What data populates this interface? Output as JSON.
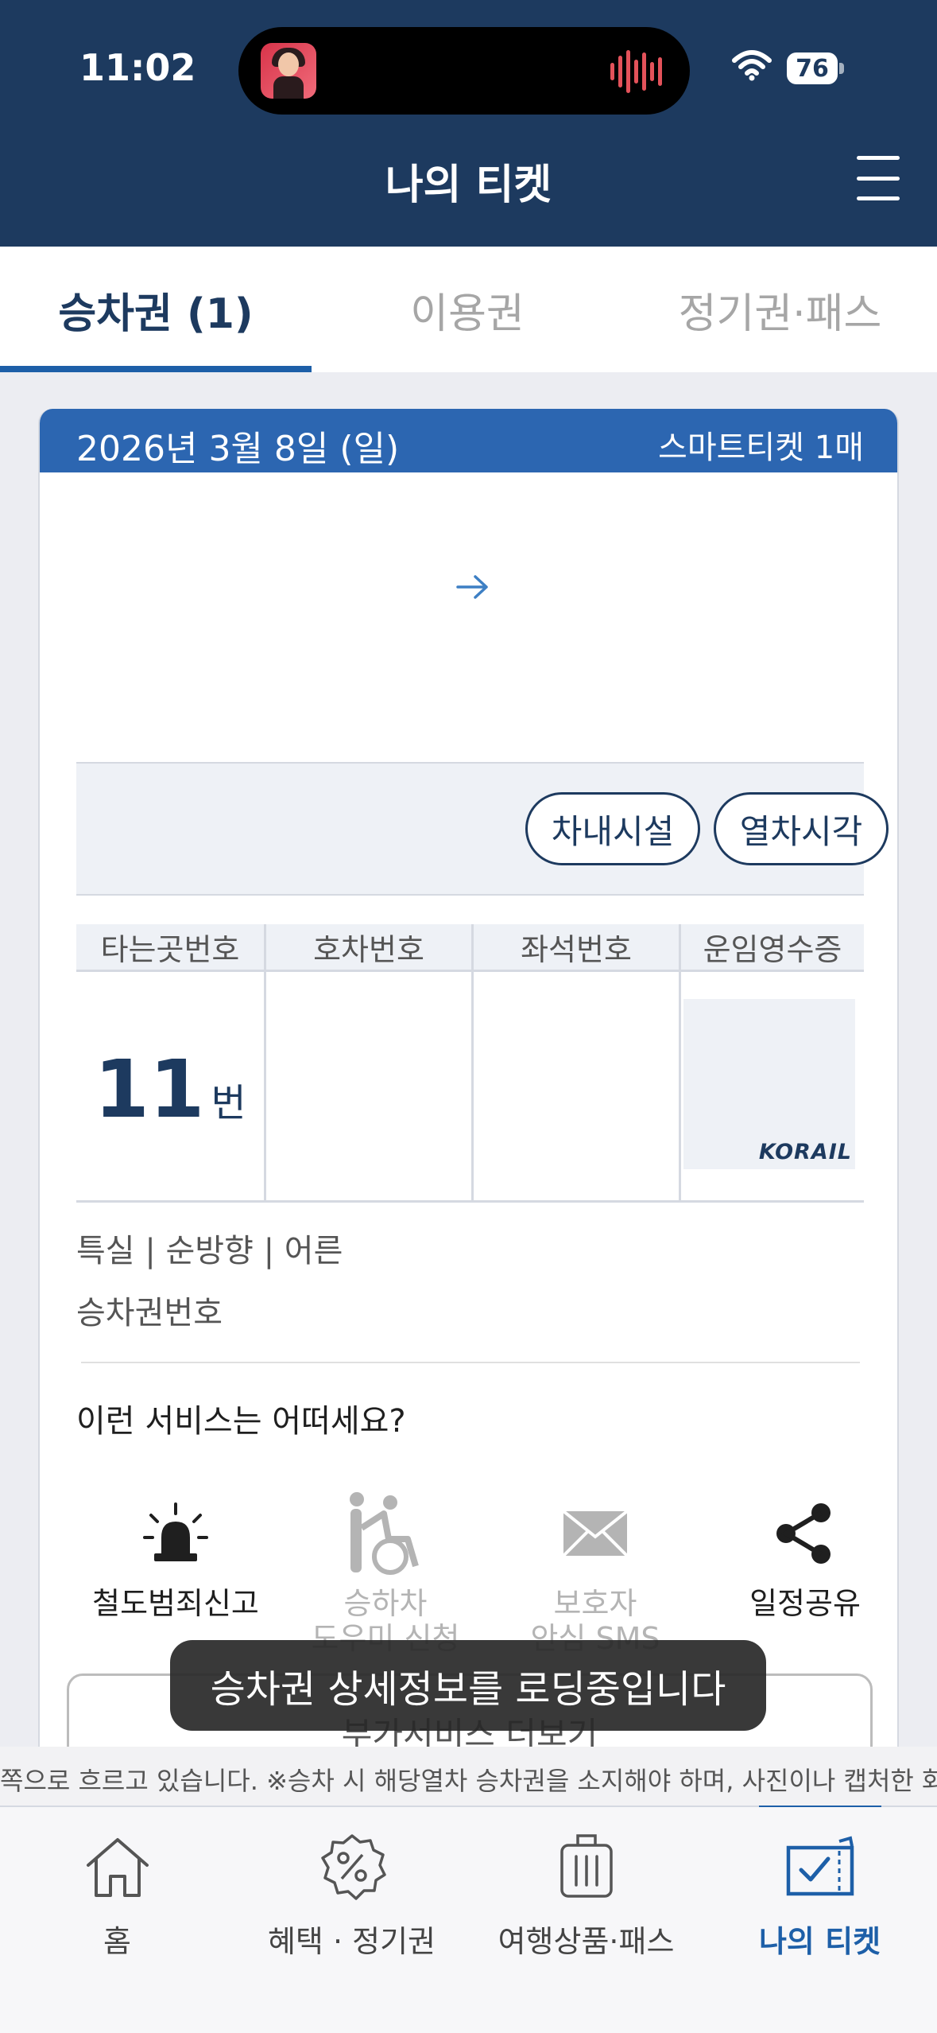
{
  "status_bar": {
    "time": "11:02",
    "battery": "76"
  },
  "header": {
    "title": "나의 티켓"
  },
  "tabs": [
    {
      "label": "승차권 (1)",
      "active": true
    },
    {
      "label": "이용권",
      "active": false
    },
    {
      "label": "정기권·패스",
      "active": false
    }
  ],
  "ticket": {
    "date": "2026년 3월 8일 (일)",
    "type": "스마트티켓 1매",
    "buttons": {
      "facilities": "차내시설",
      "timetable": "열차시각"
    },
    "table_headers": [
      "타는곳번호",
      "호차번호",
      "좌석번호",
      "운임영수증"
    ],
    "platform_number": "11",
    "platform_unit": "번",
    "receipt_logo": "KORAIL",
    "attributes": "특실 | 순방향 | 어른",
    "ticket_number_label": "승차권번호"
  },
  "services": {
    "title": "이런 서비스는 어떠세요?",
    "items": [
      {
        "label": "철도범죄신고",
        "icon": "siren-icon",
        "enabled": true
      },
      {
        "label": "승하차\n도우미 신청",
        "icon": "wheelchair-icon",
        "enabled": false
      },
      {
        "label": "보호자\n안심 SMS",
        "icon": "envelope-icon",
        "enabled": false
      },
      {
        "label": "일정공유",
        "icon": "share-icon",
        "enabled": true
      }
    ],
    "more_button": "부가서비스 더보기"
  },
  "toast": "승차권 상세정보를 로딩중입니다",
  "marquee": "쪽으로 흐르고 있습니다. ※승차 시 해당열차 승차권을 소지해야 하며, 사진이나 캡처한 화",
  "bottom_nav": [
    {
      "label": "홈",
      "icon": "home-icon",
      "active": false
    },
    {
      "label": "혜택 · 정기권",
      "icon": "discount-badge-icon",
      "active": false
    },
    {
      "label": "여행상품·패스",
      "icon": "suitcase-icon",
      "active": false
    },
    {
      "label": "나의 티켓",
      "icon": "ticket-check-icon",
      "active": true
    }
  ],
  "colors": {
    "header": "#1d3a5f",
    "accent": "#1d5fa8",
    "card_header": "#2c66b1"
  }
}
